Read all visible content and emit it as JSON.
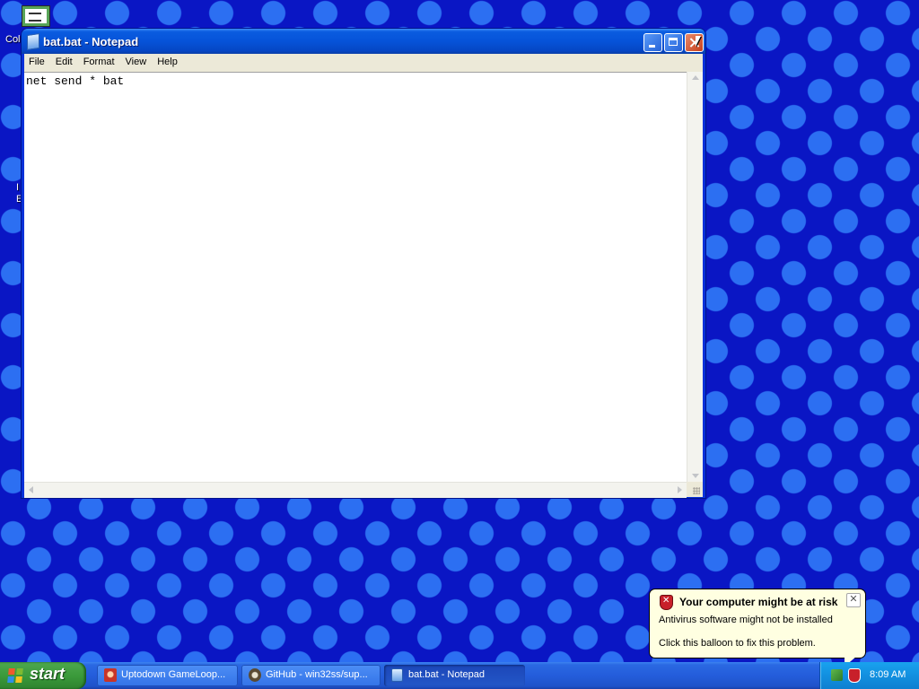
{
  "desktop": {
    "icon_label_partial": "Col",
    "side_text_1": "I",
    "side_text_2": "E"
  },
  "notepad": {
    "title": "bat.bat - Notepad",
    "menu": [
      "File",
      "Edit",
      "Format",
      "View",
      "Help"
    ],
    "content": "net send * bat"
  },
  "balloon": {
    "title": "Your computer might be at risk",
    "line1": "Antivirus software might not be installed",
    "line2": "Click this balloon to fix this problem.",
    "close_glyph": "✕"
  },
  "taskbar": {
    "start_label": "start",
    "tasks": [
      {
        "label": "Uptodown GameLoop...",
        "icon": "uptodown-icon"
      },
      {
        "label": "GitHub - win32ss/sup...",
        "icon": "github-icon"
      },
      {
        "label": "bat.bat - Notepad",
        "icon": "notepad-icon",
        "active": true
      }
    ],
    "clock": "8:09 AM"
  },
  "colors": {
    "desktop_bg": "#0a16c4",
    "titlebar": "#0653d9",
    "taskbar": "#245ddb",
    "start_green": "#3b9a3b",
    "balloon_bg": "#ffffe1"
  }
}
